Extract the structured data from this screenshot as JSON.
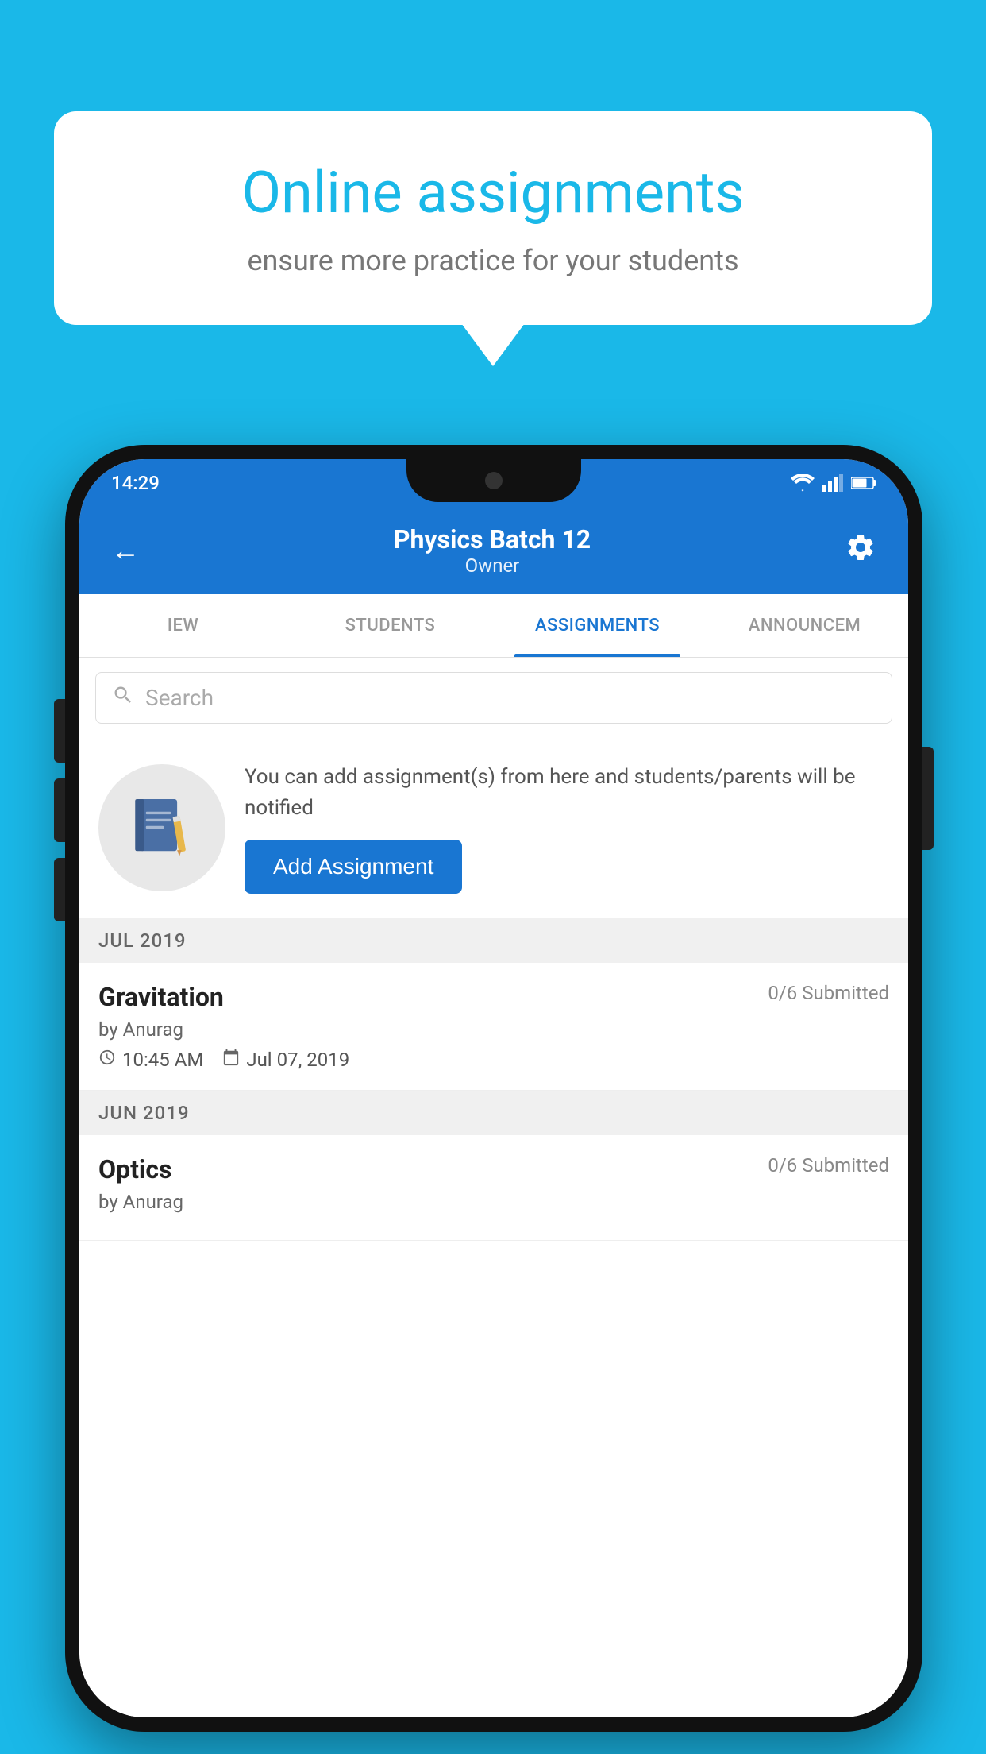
{
  "background": {
    "color": "#1ab8e8"
  },
  "speech_bubble": {
    "title": "Online assignments",
    "subtitle": "ensure more practice for your students"
  },
  "status_bar": {
    "time": "14:29"
  },
  "app_bar": {
    "title": "Physics Batch 12",
    "subtitle": "Owner",
    "back_label": "←",
    "settings_label": "⚙"
  },
  "tabs": [
    {
      "label": "IEW",
      "active": false
    },
    {
      "label": "STUDENTS",
      "active": false
    },
    {
      "label": "ASSIGNMENTS",
      "active": true
    },
    {
      "label": "ANNOUNCEM",
      "active": false
    }
  ],
  "search": {
    "placeholder": "Search"
  },
  "promo": {
    "description": "You can add assignment(s) from here and students/parents will be notified",
    "button_label": "Add Assignment"
  },
  "sections": [
    {
      "header": "JUL 2019",
      "assignments": [
        {
          "title": "Gravitation",
          "submitted": "0/6 Submitted",
          "author": "by Anurag",
          "time": "10:45 AM",
          "date": "Jul 07, 2019"
        }
      ]
    },
    {
      "header": "JUN 2019",
      "assignments": [
        {
          "title": "Optics",
          "submitted": "0/6 Submitted",
          "author": "by Anurag",
          "time": "",
          "date": ""
        }
      ]
    }
  ]
}
